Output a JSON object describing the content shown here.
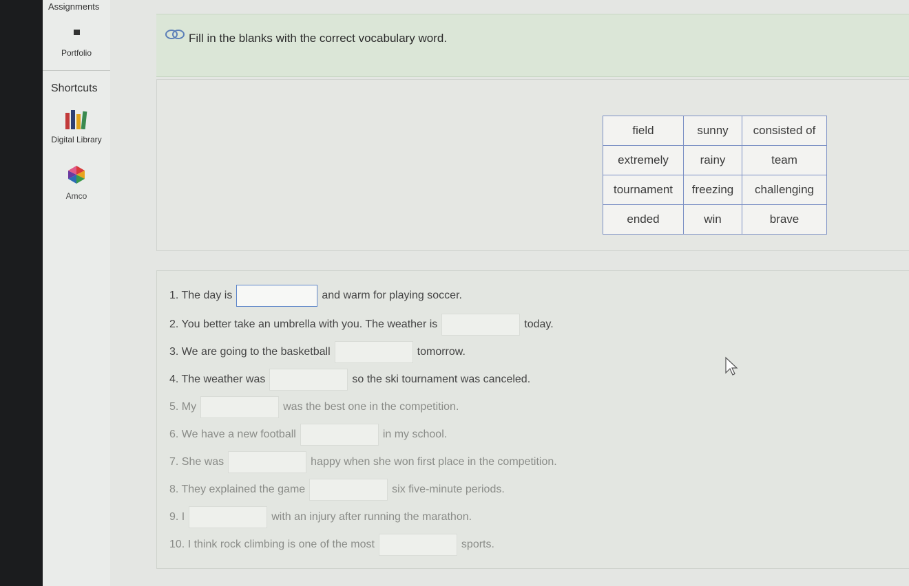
{
  "sidebar": {
    "assignments_label": "Assignments",
    "portfolio_label": "Portfolio",
    "shortcuts_title": "Shortcuts",
    "digital_library_label": "Digital Library",
    "amco_label": "Amco"
  },
  "instruction": {
    "text": "Fill in the blanks with the correct vocabulary word.",
    "icon": "link-icon"
  },
  "word_bank": {
    "rows": [
      [
        "field",
        "sunny",
        "consisted of"
      ],
      [
        "extremely",
        "rainy",
        "team"
      ],
      [
        "tournament",
        "freezing",
        "challenging"
      ],
      [
        "ended",
        "win",
        "brave"
      ]
    ]
  },
  "sentences": [
    {
      "before": "1. The day is",
      "after": "and warm for playing soccer.",
      "value": ""
    },
    {
      "before": "2. You better take an umbrella with you. The weather is",
      "after": "today.",
      "value": ""
    },
    {
      "before": "3. We are going to the basketball",
      "after": "tomorrow.",
      "value": ""
    },
    {
      "before": "4. The weather was",
      "after": "so the ski tournament was canceled.",
      "value": ""
    },
    {
      "before": "5. My",
      "after": "was the best one in the competition.",
      "value": ""
    },
    {
      "before": "6. We have a new football",
      "after": "in my school.",
      "value": ""
    },
    {
      "before": "7. She was",
      "after": "happy when she won first place in the competition.",
      "value": ""
    },
    {
      "before": "8. They explained the game",
      "after": "six five-minute periods.",
      "value": ""
    },
    {
      "before": "9. I",
      "after": "with an injury after running the marathon.",
      "value": ""
    },
    {
      "before": "10. I think rock climbing is one of the most",
      "after": "sports.",
      "value": ""
    }
  ]
}
